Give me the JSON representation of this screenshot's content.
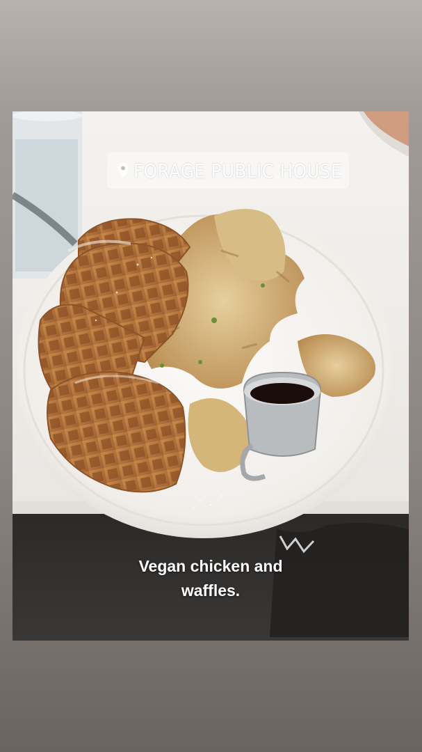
{
  "story": {
    "location_sticker": {
      "icon": "location-pin-icon",
      "text": "FORAGE PUBLIC HOUSE"
    },
    "caption": {
      "line1": "Vegan chicken and",
      "line2": "waffles."
    }
  },
  "colors": {
    "background_top": "#b8b1ad",
    "background_bottom": "#6a6461",
    "sticker_text": "#ffffff",
    "caption_text": "#ffffff"
  }
}
